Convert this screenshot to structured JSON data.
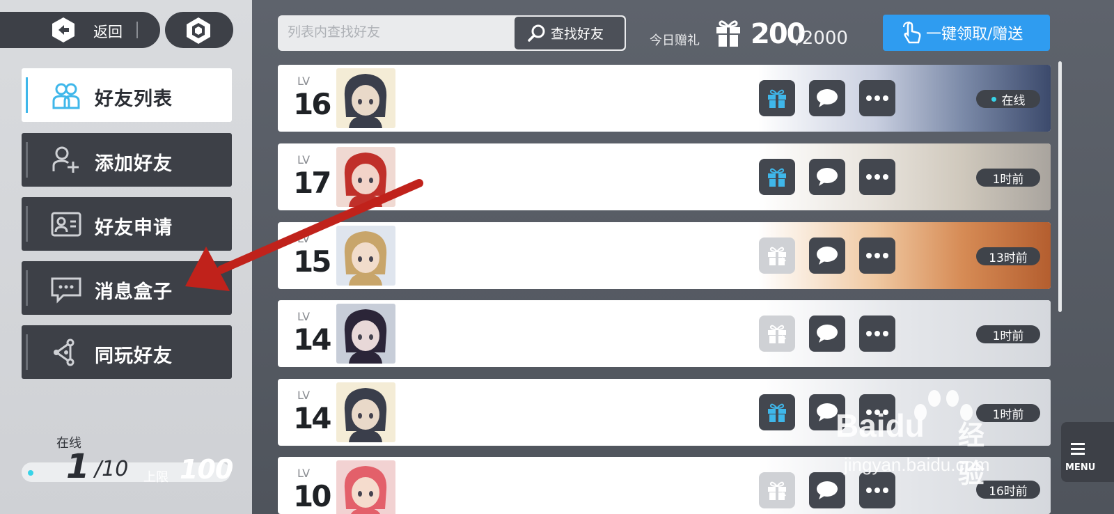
{
  "header": {
    "back_label": "返回",
    "search_placeholder": "列表内查找好友",
    "search_button": "查找好友",
    "gift_label": "今日赠礼",
    "gift_count": "200",
    "gift_max": "/2000",
    "claim_button": "一键领取/赠送"
  },
  "sidebar": {
    "items": [
      {
        "label": "好友列表",
        "icon": "friends-icon",
        "active": true
      },
      {
        "label": "添加好友",
        "icon": "add-user-icon",
        "active": false
      },
      {
        "label": "好友申请",
        "icon": "id-card-icon",
        "active": false
      },
      {
        "label": "消息盒子",
        "icon": "message-box-icon",
        "active": false
      },
      {
        "label": "同玩好友",
        "icon": "share-nodes-icon",
        "active": false
      }
    ],
    "online_label": "在线",
    "online_count": "1",
    "online_max": "/10",
    "limit_label": "上限",
    "limit_value": "100"
  },
  "friends": [
    {
      "lv_tag": "LV",
      "level": "16",
      "status": "在线",
      "online": true,
      "gift_available": true
    },
    {
      "lv_tag": "LV",
      "level": "17",
      "status": "1时前",
      "online": false,
      "gift_available": true
    },
    {
      "lv_tag": "LV",
      "level": "15",
      "status": "13时前",
      "online": false,
      "gift_available": false
    },
    {
      "lv_tag": "LV",
      "level": "14",
      "status": "1时前",
      "online": false,
      "gift_available": false
    },
    {
      "lv_tag": "LV",
      "level": "14",
      "status": "1时前",
      "online": false,
      "gift_available": true
    },
    {
      "lv_tag": "LV",
      "level": "10",
      "status": "16时前",
      "online": false,
      "gift_available": false
    }
  ],
  "menu_tab": "MENU",
  "watermark": {
    "brand": "Baidu",
    "cn": "经验",
    "url": "jingyan.baidu.com"
  },
  "colors": {
    "accent": "#2f9cf0",
    "dark_panel": "#3d4047",
    "online_dot": "#37d3e8",
    "arrow": "#c0221b"
  }
}
